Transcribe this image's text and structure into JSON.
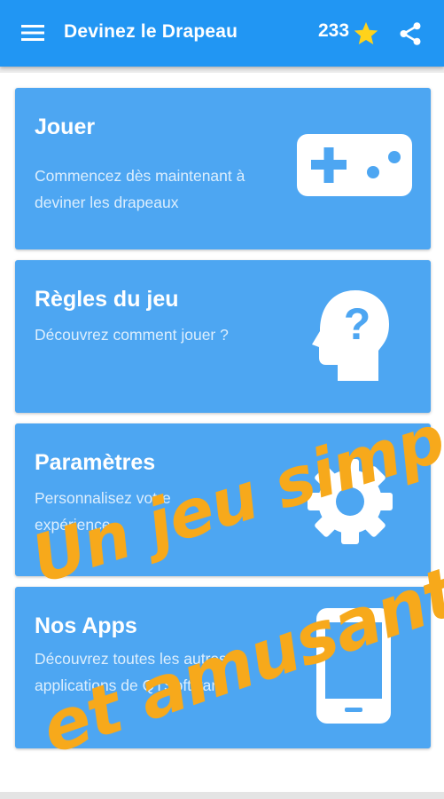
{
  "app_bar": {
    "title": "Devinez le Drapeau",
    "score": "233",
    "menu_icon": "hamburger-menu-icon",
    "star_icon": "star-icon",
    "share_icon": "share-icon",
    "color": "#2196f3"
  },
  "cards": [
    {
      "title": "Jouer",
      "description": "Commencez dès maintenant à deviner les drapeaux",
      "icon": "gamepad-icon"
    },
    {
      "title": "Règles du jeu",
      "description": "Découvrez comment jouer ?",
      "icon": "head-question-icon"
    },
    {
      "title": "Paramètres",
      "description": "Personnalisez votre expérience",
      "icon": "gear-icon"
    },
    {
      "title": "Nos Apps",
      "description": "Découvrez toutes les autres applications de QTSoftware",
      "icon": "smartphone-icon"
    }
  ],
  "promo": {
    "line1": "Un jeu simple",
    "line2": "et amusant !",
    "color": "#f7a91b"
  },
  "colors": {
    "card": "#4da6f2",
    "star": "#ffd21a"
  }
}
